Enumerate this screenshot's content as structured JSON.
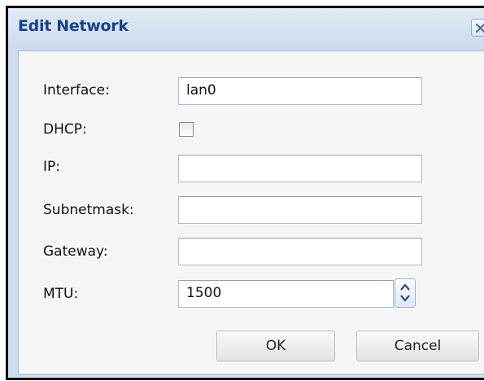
{
  "dialog": {
    "title": "Edit Network",
    "close_icon": "close-icon"
  },
  "form": {
    "interface": {
      "label": "Interface:",
      "value": "lan0"
    },
    "dhcp": {
      "label": "DHCP:",
      "checked": false
    },
    "ip": {
      "label": "IP:",
      "value": ""
    },
    "subnetmask": {
      "label": "Subnetmask:",
      "value": ""
    },
    "gateway": {
      "label": "Gateway:",
      "value": ""
    },
    "mtu": {
      "label": "MTU:",
      "value": "1500",
      "spinner_icon": "spinner-updown-icon"
    }
  },
  "buttons": {
    "ok": "OK",
    "cancel": "Cancel"
  },
  "colors": {
    "title": "#15428b",
    "frame": "#cfdcec",
    "panel": "#f6f6f6"
  }
}
